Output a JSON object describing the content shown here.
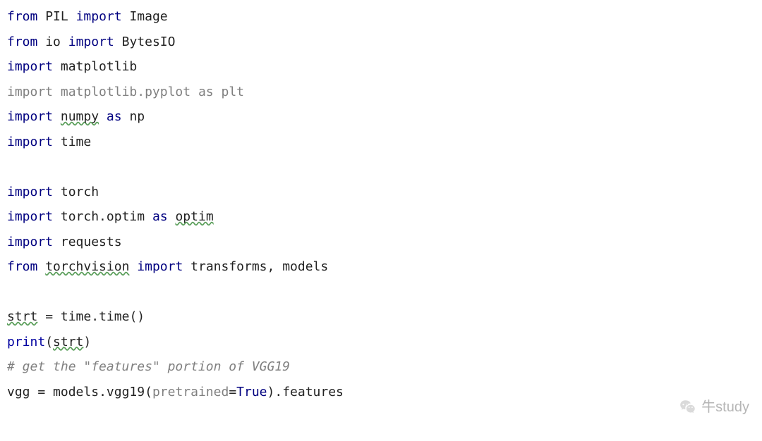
{
  "lines": {
    "l1": {
      "from": "from",
      "pil": "PIL",
      "import": "import",
      "image": "Image"
    },
    "l2": {
      "from": "from",
      "io": "io",
      "import": "import",
      "bytesio": "BytesIO"
    },
    "l3": {
      "import": "import",
      "matplotlib": "matplotlib"
    },
    "l4": {
      "import": "import",
      "pyplot": "matplotlib.pyplot",
      "as": "as",
      "plt": "plt"
    },
    "l5": {
      "import": "import",
      "numpy": "numpy",
      "as": "as",
      "np": "np"
    },
    "l6": {
      "import": "import",
      "time": "time"
    },
    "l8": {
      "import": "import",
      "torch": "torch"
    },
    "l9": {
      "import": "import",
      "torchoptim": "torch.optim",
      "as": "as",
      "optim": "optim"
    },
    "l10": {
      "import": "import",
      "requests": "requests"
    },
    "l11": {
      "from": "from",
      "torchvision": "torchvision",
      "import": "import",
      "transforms": "transforms",
      "comma": ", ",
      "models": "models"
    },
    "l13": {
      "strt": "strt",
      "eq": " = ",
      "time1": "time",
      "dot": ".",
      "time2": "time",
      "paren": "()"
    },
    "l14": {
      "print": "print",
      "open": "(",
      "strt": "strt",
      "close": ")"
    },
    "l15": {
      "comment": "# get the \"features\" portion of VGG19"
    },
    "l16": {
      "vgg": "vgg",
      "eq": " = ",
      "models": "models",
      "dot1": ".",
      "vgg19": "vgg19",
      "open": "(",
      "pretrained": "pretrained",
      "eq2": "=",
      "true": "True",
      "close": ")",
      "dot2": ".",
      "features": "features"
    }
  },
  "watermark": {
    "text": "牛study"
  }
}
